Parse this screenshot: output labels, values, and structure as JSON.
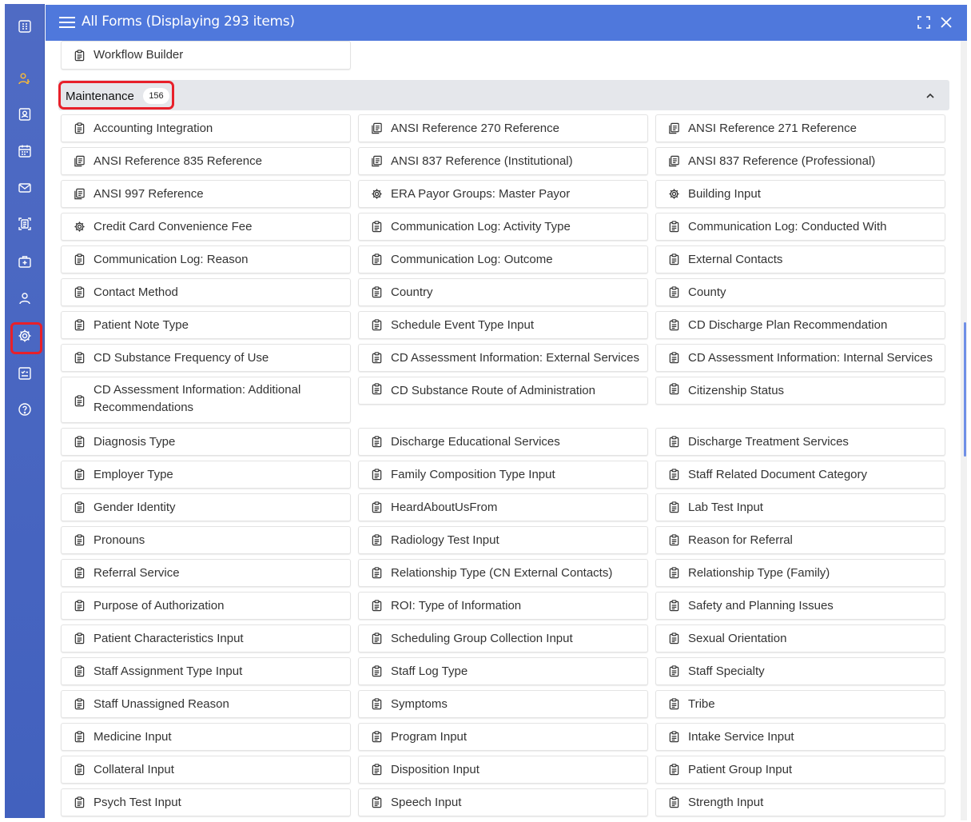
{
  "header": {
    "title": "All Forms (Displaying 293 items)",
    "menu_icon": "hamburger-menu-icon",
    "expand_icon": "expand-icon",
    "close_icon": "close-icon",
    "color": "#4f78dc"
  },
  "rail": {
    "color": "#4a66c2",
    "items": [
      {
        "name": "dashboard-grid-icon",
        "selected": false
      },
      {
        "name": "user-key-icon",
        "selected": false
      },
      {
        "name": "contact-card-icon",
        "selected": false
      },
      {
        "name": "calendar-icon",
        "selected": false
      },
      {
        "name": "mail-icon",
        "selected": false
      },
      {
        "name": "document-scan-icon",
        "selected": false
      },
      {
        "name": "medical-case-icon",
        "selected": false
      },
      {
        "name": "person-icon",
        "selected": false
      },
      {
        "name": "settings-gear-icon",
        "selected": true
      },
      {
        "name": "checklist-icon",
        "selected": false
      },
      {
        "name": "help-icon",
        "selected": false
      }
    ]
  },
  "previous_item": {
    "label": "Workflow Builder",
    "icon": "clipboard-icon"
  },
  "section": {
    "title": "Maintenance",
    "count": "156",
    "collapse_icon": "chevron-up-icon",
    "highlight_color": "#e8202a"
  },
  "forms": [
    {
      "label": "Accounting Integration",
      "icon": "clipboard-icon"
    },
    {
      "label": "ANSI Reference 270 Reference",
      "icon": "document-copy-icon"
    },
    {
      "label": "ANSI Reference 271 Reference",
      "icon": "document-copy-icon"
    },
    {
      "label": "ANSI Reference 835 Reference",
      "icon": "document-copy-icon"
    },
    {
      "label": "ANSI 837 Reference (Institutional)",
      "icon": "document-copy-icon"
    },
    {
      "label": "ANSI 837 Reference (Professional)",
      "icon": "document-copy-icon"
    },
    {
      "label": "ANSI 997 Reference",
      "icon": "document-copy-icon"
    },
    {
      "label": "ERA Payor Groups: Master Payor",
      "icon": "gear-icon"
    },
    {
      "label": "Building Input",
      "icon": "gear-icon"
    },
    {
      "label": "Credit Card Convenience Fee",
      "icon": "gear-icon"
    },
    {
      "label": "Communication Log: Activity Type",
      "icon": "clipboard-icon"
    },
    {
      "label": "Communication Log: Conducted With",
      "icon": "clipboard-icon"
    },
    {
      "label": "Communication Log: Reason",
      "icon": "clipboard-icon"
    },
    {
      "label": "Communication Log: Outcome",
      "icon": "clipboard-icon"
    },
    {
      "label": "External Contacts",
      "icon": "clipboard-icon"
    },
    {
      "label": "Contact Method",
      "icon": "clipboard-icon"
    },
    {
      "label": "Country",
      "icon": "clipboard-icon"
    },
    {
      "label": "County",
      "icon": "clipboard-icon"
    },
    {
      "label": "Patient Note Type",
      "icon": "clipboard-icon"
    },
    {
      "label": "Schedule Event Type Input",
      "icon": "clipboard-icon"
    },
    {
      "label": "CD Discharge Plan Recommendation",
      "icon": "clipboard-icon"
    },
    {
      "label": "CD Substance Frequency of Use",
      "icon": "clipboard-icon"
    },
    {
      "label": "CD Assessment Information: External Services",
      "icon": "clipboard-icon"
    },
    {
      "label": "CD Assessment Information: Internal Services",
      "icon": "clipboard-icon"
    },
    {
      "label": "CD Assessment Information: Additional Recommendations",
      "icon": "clipboard-icon"
    },
    {
      "label": "CD Substance Route of Administration",
      "icon": "clipboard-icon"
    },
    {
      "label": "Citizenship Status",
      "icon": "clipboard-icon"
    },
    {
      "label": "Diagnosis Type",
      "icon": "clipboard-icon"
    },
    {
      "label": "Discharge Educational Services",
      "icon": "clipboard-icon"
    },
    {
      "label": "Discharge Treatment Services",
      "icon": "clipboard-icon"
    },
    {
      "label": "Employer Type",
      "icon": "clipboard-icon"
    },
    {
      "label": "Family Composition Type Input",
      "icon": "clipboard-icon"
    },
    {
      "label": "Staff Related Document Category",
      "icon": "clipboard-icon"
    },
    {
      "label": "Gender Identity",
      "icon": "clipboard-icon"
    },
    {
      "label": "HeardAboutUsFrom",
      "icon": "clipboard-icon"
    },
    {
      "label": "Lab Test Input",
      "icon": "clipboard-icon"
    },
    {
      "label": "Pronouns",
      "icon": "clipboard-icon"
    },
    {
      "label": "Radiology Test Input",
      "icon": "clipboard-icon"
    },
    {
      "label": "Reason for Referral",
      "icon": "clipboard-icon"
    },
    {
      "label": "Referral Service",
      "icon": "clipboard-icon"
    },
    {
      "label": "Relationship Type (CN External Contacts)",
      "icon": "clipboard-icon"
    },
    {
      "label": "Relationship Type (Family)",
      "icon": "clipboard-icon"
    },
    {
      "label": "Purpose of Authorization",
      "icon": "clipboard-icon"
    },
    {
      "label": "ROI: Type of Information",
      "icon": "clipboard-icon"
    },
    {
      "label": "Safety and Planning Issues",
      "icon": "clipboard-icon"
    },
    {
      "label": "Patient Characteristics Input",
      "icon": "clipboard-icon"
    },
    {
      "label": "Scheduling Group Collection Input",
      "icon": "clipboard-icon"
    },
    {
      "label": "Sexual Orientation",
      "icon": "clipboard-icon"
    },
    {
      "label": "Staff Assignment Type Input",
      "icon": "clipboard-icon"
    },
    {
      "label": "Staff Log Type",
      "icon": "clipboard-icon"
    },
    {
      "label": "Staff Specialty",
      "icon": "clipboard-icon"
    },
    {
      "label": "Staff Unassigned Reason",
      "icon": "clipboard-icon"
    },
    {
      "label": "Symptoms",
      "icon": "clipboard-icon"
    },
    {
      "label": "Tribe",
      "icon": "clipboard-icon"
    },
    {
      "label": "Medicine Input",
      "icon": "clipboard-icon"
    },
    {
      "label": "Program Input",
      "icon": "clipboard-icon"
    },
    {
      "label": "Intake Service Input",
      "icon": "clipboard-icon"
    },
    {
      "label": "Collateral Input",
      "icon": "clipboard-icon"
    },
    {
      "label": "Disposition Input",
      "icon": "clipboard-icon"
    },
    {
      "label": "Patient Group Input",
      "icon": "clipboard-icon"
    },
    {
      "label": "Psych Test Input",
      "icon": "clipboard-icon"
    },
    {
      "label": "Speech Input",
      "icon": "clipboard-icon"
    },
    {
      "label": "Strength Input",
      "icon": "clipboard-icon"
    }
  ]
}
